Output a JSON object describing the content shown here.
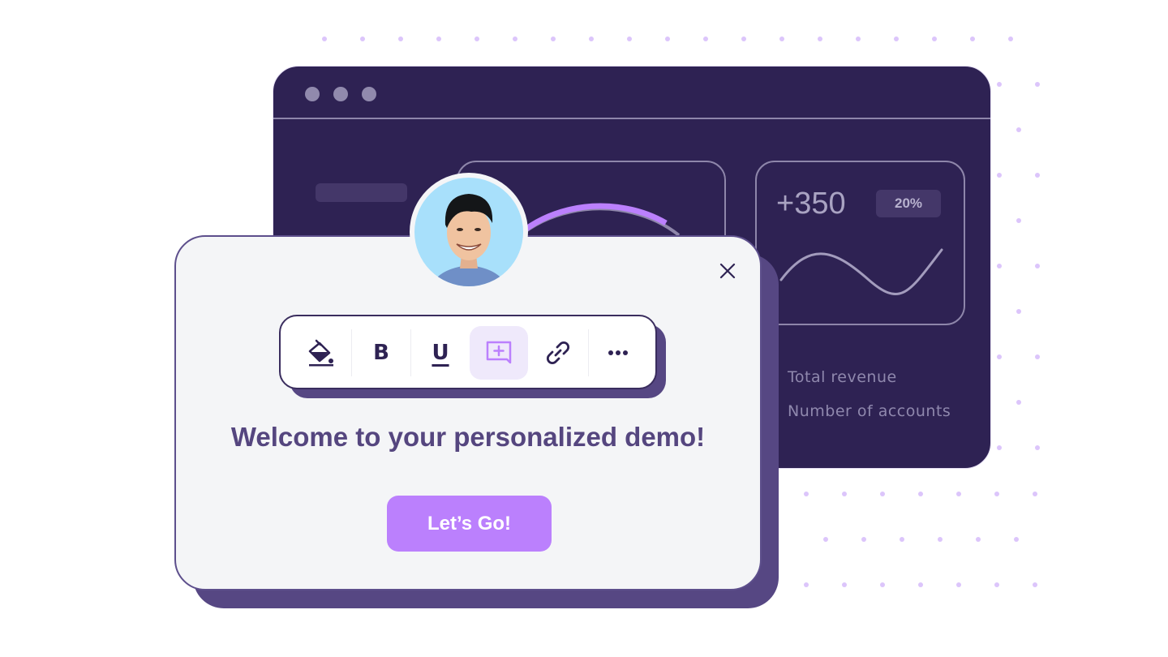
{
  "dashboard": {
    "stat_card": {
      "value": "+350",
      "badge": "20%"
    },
    "legend": [
      {
        "label": "Total revenue"
      },
      {
        "label": "Number of accounts"
      }
    ],
    "gauge_fraction": 0.75
  },
  "modal": {
    "title": "Welcome to your personalized demo!",
    "cta_label": "Let’s Go!",
    "close_icon": "close-icon",
    "avatar": "user-avatar-photo"
  },
  "toolbar": {
    "tools": [
      {
        "name": "fill-color",
        "icon": "paint-bucket-icon",
        "active": false
      },
      {
        "name": "bold",
        "icon": "bold-icon",
        "label": "B",
        "active": false
      },
      {
        "name": "underline",
        "icon": "underline-icon",
        "label": "U",
        "active": false
      },
      {
        "name": "add-comment",
        "icon": "comment-plus-icon",
        "active": true
      },
      {
        "name": "link",
        "icon": "link-icon",
        "active": false
      },
      {
        "name": "more",
        "icon": "more-horizontal-icon",
        "active": false
      }
    ]
  },
  "colors": {
    "dashboard_bg": "#2e2253",
    "accent": "#bb80fd",
    "modal_bg": "#f4f5f7",
    "modal_shadow": "#564783",
    "title_text": "#55467f",
    "dot_pattern": "#dcc5fb"
  }
}
